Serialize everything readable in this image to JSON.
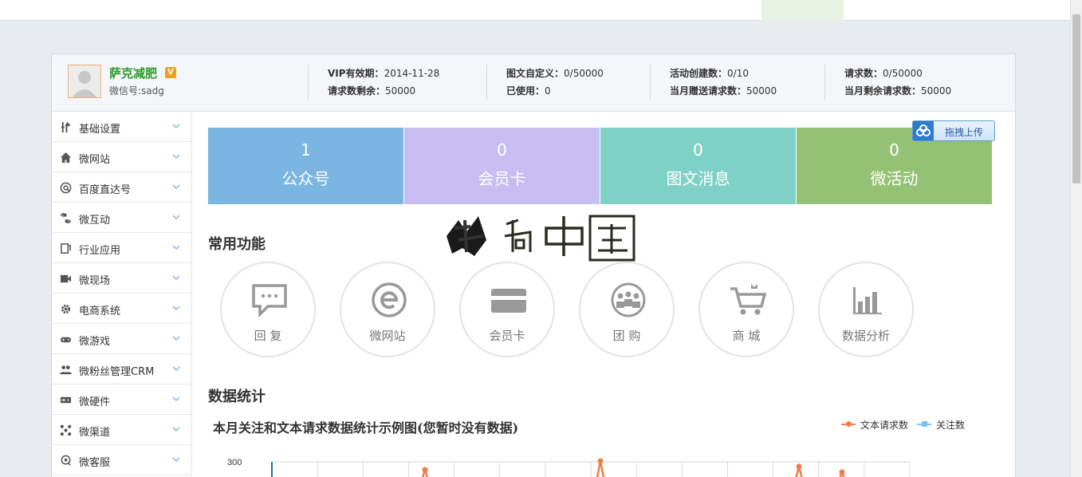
{
  "profile": {
    "name": "萨克减肥",
    "badge": "V",
    "wechat_id": "微信号:sadg",
    "stats": [
      {
        "line1_label": "VIP有效期：",
        "line1_value": "2014-11-28",
        "line2_label": "请求数剩余：",
        "line2_value": "50000"
      },
      {
        "line1_label": "图文自定义：",
        "line1_value": "0/50000",
        "line2_label": "已使用：",
        "line2_value": "0"
      },
      {
        "line1_label": "活动创建数：",
        "line1_value": "0/10",
        "line2_label": "当月赠送请求数：",
        "line2_value": "50000"
      },
      {
        "line1_label": "请求数：",
        "line1_value": "0/50000",
        "line2_label": "当月剩余请求数：",
        "line2_value": "50000"
      }
    ]
  },
  "sidebar": {
    "items": [
      {
        "label": "基础设置",
        "icon": "tools-icon"
      },
      {
        "label": "微网站",
        "icon": "home-icon"
      },
      {
        "label": "百度直达号",
        "icon": "at-icon"
      },
      {
        "label": "微互动",
        "icon": "interact-icon"
      },
      {
        "label": "行业应用",
        "icon": "document-icon"
      },
      {
        "label": "微现场",
        "icon": "video-icon"
      },
      {
        "label": "电商系统",
        "icon": "gear-icon"
      },
      {
        "label": "微游戏",
        "icon": "gamepad-icon"
      },
      {
        "label": "微粉丝管理CRM",
        "icon": "users-icon"
      },
      {
        "label": "微硬件",
        "icon": "hardware-icon"
      },
      {
        "label": "微渠道",
        "icon": "network-icon"
      },
      {
        "label": "微客服",
        "icon": "service-icon"
      }
    ]
  },
  "tiles": [
    {
      "number": "1",
      "label": "公众号",
      "color": "#7bb5e2"
    },
    {
      "number": "0",
      "label": "会员卡",
      "color": "#c8bdf2"
    },
    {
      "number": "0",
      "label": "图文消息",
      "color": "#7fd1c7"
    },
    {
      "number": "0",
      "label": "微活动",
      "color": "#93c274"
    }
  ],
  "upload_button": {
    "label": "拖拽上传"
  },
  "sections": {
    "common": "常用功能",
    "stats": "数据统计"
  },
  "functions": [
    {
      "label": "回 复",
      "icon": "message-icon"
    },
    {
      "label": "微网站",
      "icon": "e-icon"
    },
    {
      "label": "会员卡",
      "icon": "card-icon"
    },
    {
      "label": "团 购",
      "icon": "group-icon"
    },
    {
      "label": "商 城",
      "icon": "cart-icon"
    },
    {
      "label": "数据分析",
      "icon": "bar-chart-icon"
    }
  ],
  "chart_data": {
    "type": "line",
    "title": "本月关注和文本请求数据统计示例图(您暂时没有数据)",
    "series": [
      {
        "name": "文本请求数",
        "color": "#f07c47"
      },
      {
        "name": "关注数",
        "color": "#7cc3ef"
      }
    ],
    "y_tick_top": "300",
    "legend_position": "top-right",
    "grid": true
  }
}
